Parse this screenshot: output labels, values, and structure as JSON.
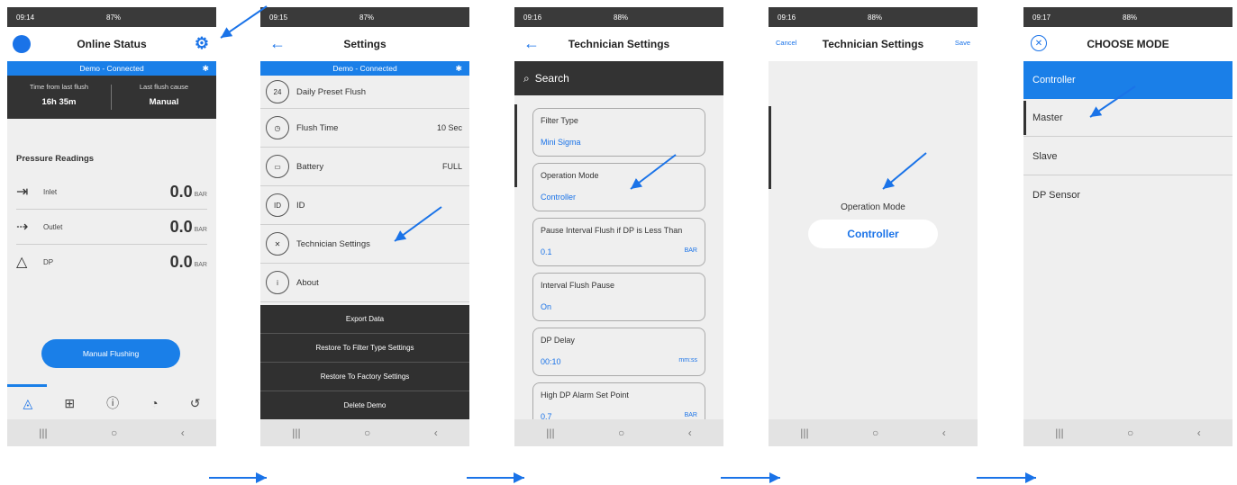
{
  "screens": [
    {
      "time": "09:14",
      "status": "87%",
      "title": "Online Status",
      "connection": "Demo - Connected",
      "flush_time_label": "Time from last flush",
      "flush_time_value": "16h 35m",
      "flush_cause_label": "Last flush cause",
      "flush_cause_value": "Manual",
      "section": "Pressure Readings",
      "readings": [
        {
          "label": "Inlet",
          "value": "0.0",
          "unit": "BAR"
        },
        {
          "label": "Outlet",
          "value": "0.0",
          "unit": "BAR"
        },
        {
          "label": "DP",
          "value": "0.0",
          "unit": "BAR"
        }
      ],
      "button": "Manual Flushing"
    },
    {
      "time": "09:15",
      "status": "87%",
      "title": "Settings",
      "connection": "Demo - Connected",
      "items": [
        {
          "icon": "24",
          "label": "Daily Preset Flush",
          "value": ""
        },
        {
          "icon": "◷",
          "label": "Flush Time",
          "value": "10 Sec"
        },
        {
          "icon": "▭",
          "label": "Battery",
          "value": "FULL"
        },
        {
          "icon": "ID",
          "label": "ID",
          "value": ""
        },
        {
          "icon": "✕",
          "label": "Technician Settings",
          "value": ""
        },
        {
          "icon": "i",
          "label": "About",
          "value": ""
        }
      ],
      "actions": [
        "Export Data",
        "Restore To Filter Type Settings",
        "Restore To Factory Settings",
        "Delete Demo"
      ]
    },
    {
      "time": "09:16",
      "status": "88%",
      "title": "Technician Settings",
      "search": "Search",
      "cards": [
        {
          "label": "Filter Type",
          "value": "Mini Sigma",
          "unit": ""
        },
        {
          "label": "Operation Mode",
          "value": "Controller",
          "unit": ""
        },
        {
          "label": "Pause Interval Flush if DP is Less Than",
          "value": "0.1",
          "unit": "BAR"
        },
        {
          "label": "Interval Flush Pause",
          "value": "On",
          "unit": ""
        },
        {
          "label": "DP Delay",
          "value": "00:10",
          "unit": "mm:ss"
        },
        {
          "label": "High DP Alarm Set Point",
          "value": "0.7",
          "unit": "BAR"
        }
      ]
    },
    {
      "time": "09:16",
      "status": "88%",
      "title": "Technician Settings",
      "cancel": "Cancel",
      "save": "Save",
      "field_label": "Operation Mode",
      "field_value": "Controller"
    },
    {
      "time": "09:17",
      "status": "88%",
      "title": "CHOOSE MODE",
      "options": [
        "Controller",
        "Master",
        "Slave",
        "DP Sensor"
      ]
    }
  ],
  "colors": {
    "accent": "#1a7fe8",
    "dark": "#333333"
  }
}
